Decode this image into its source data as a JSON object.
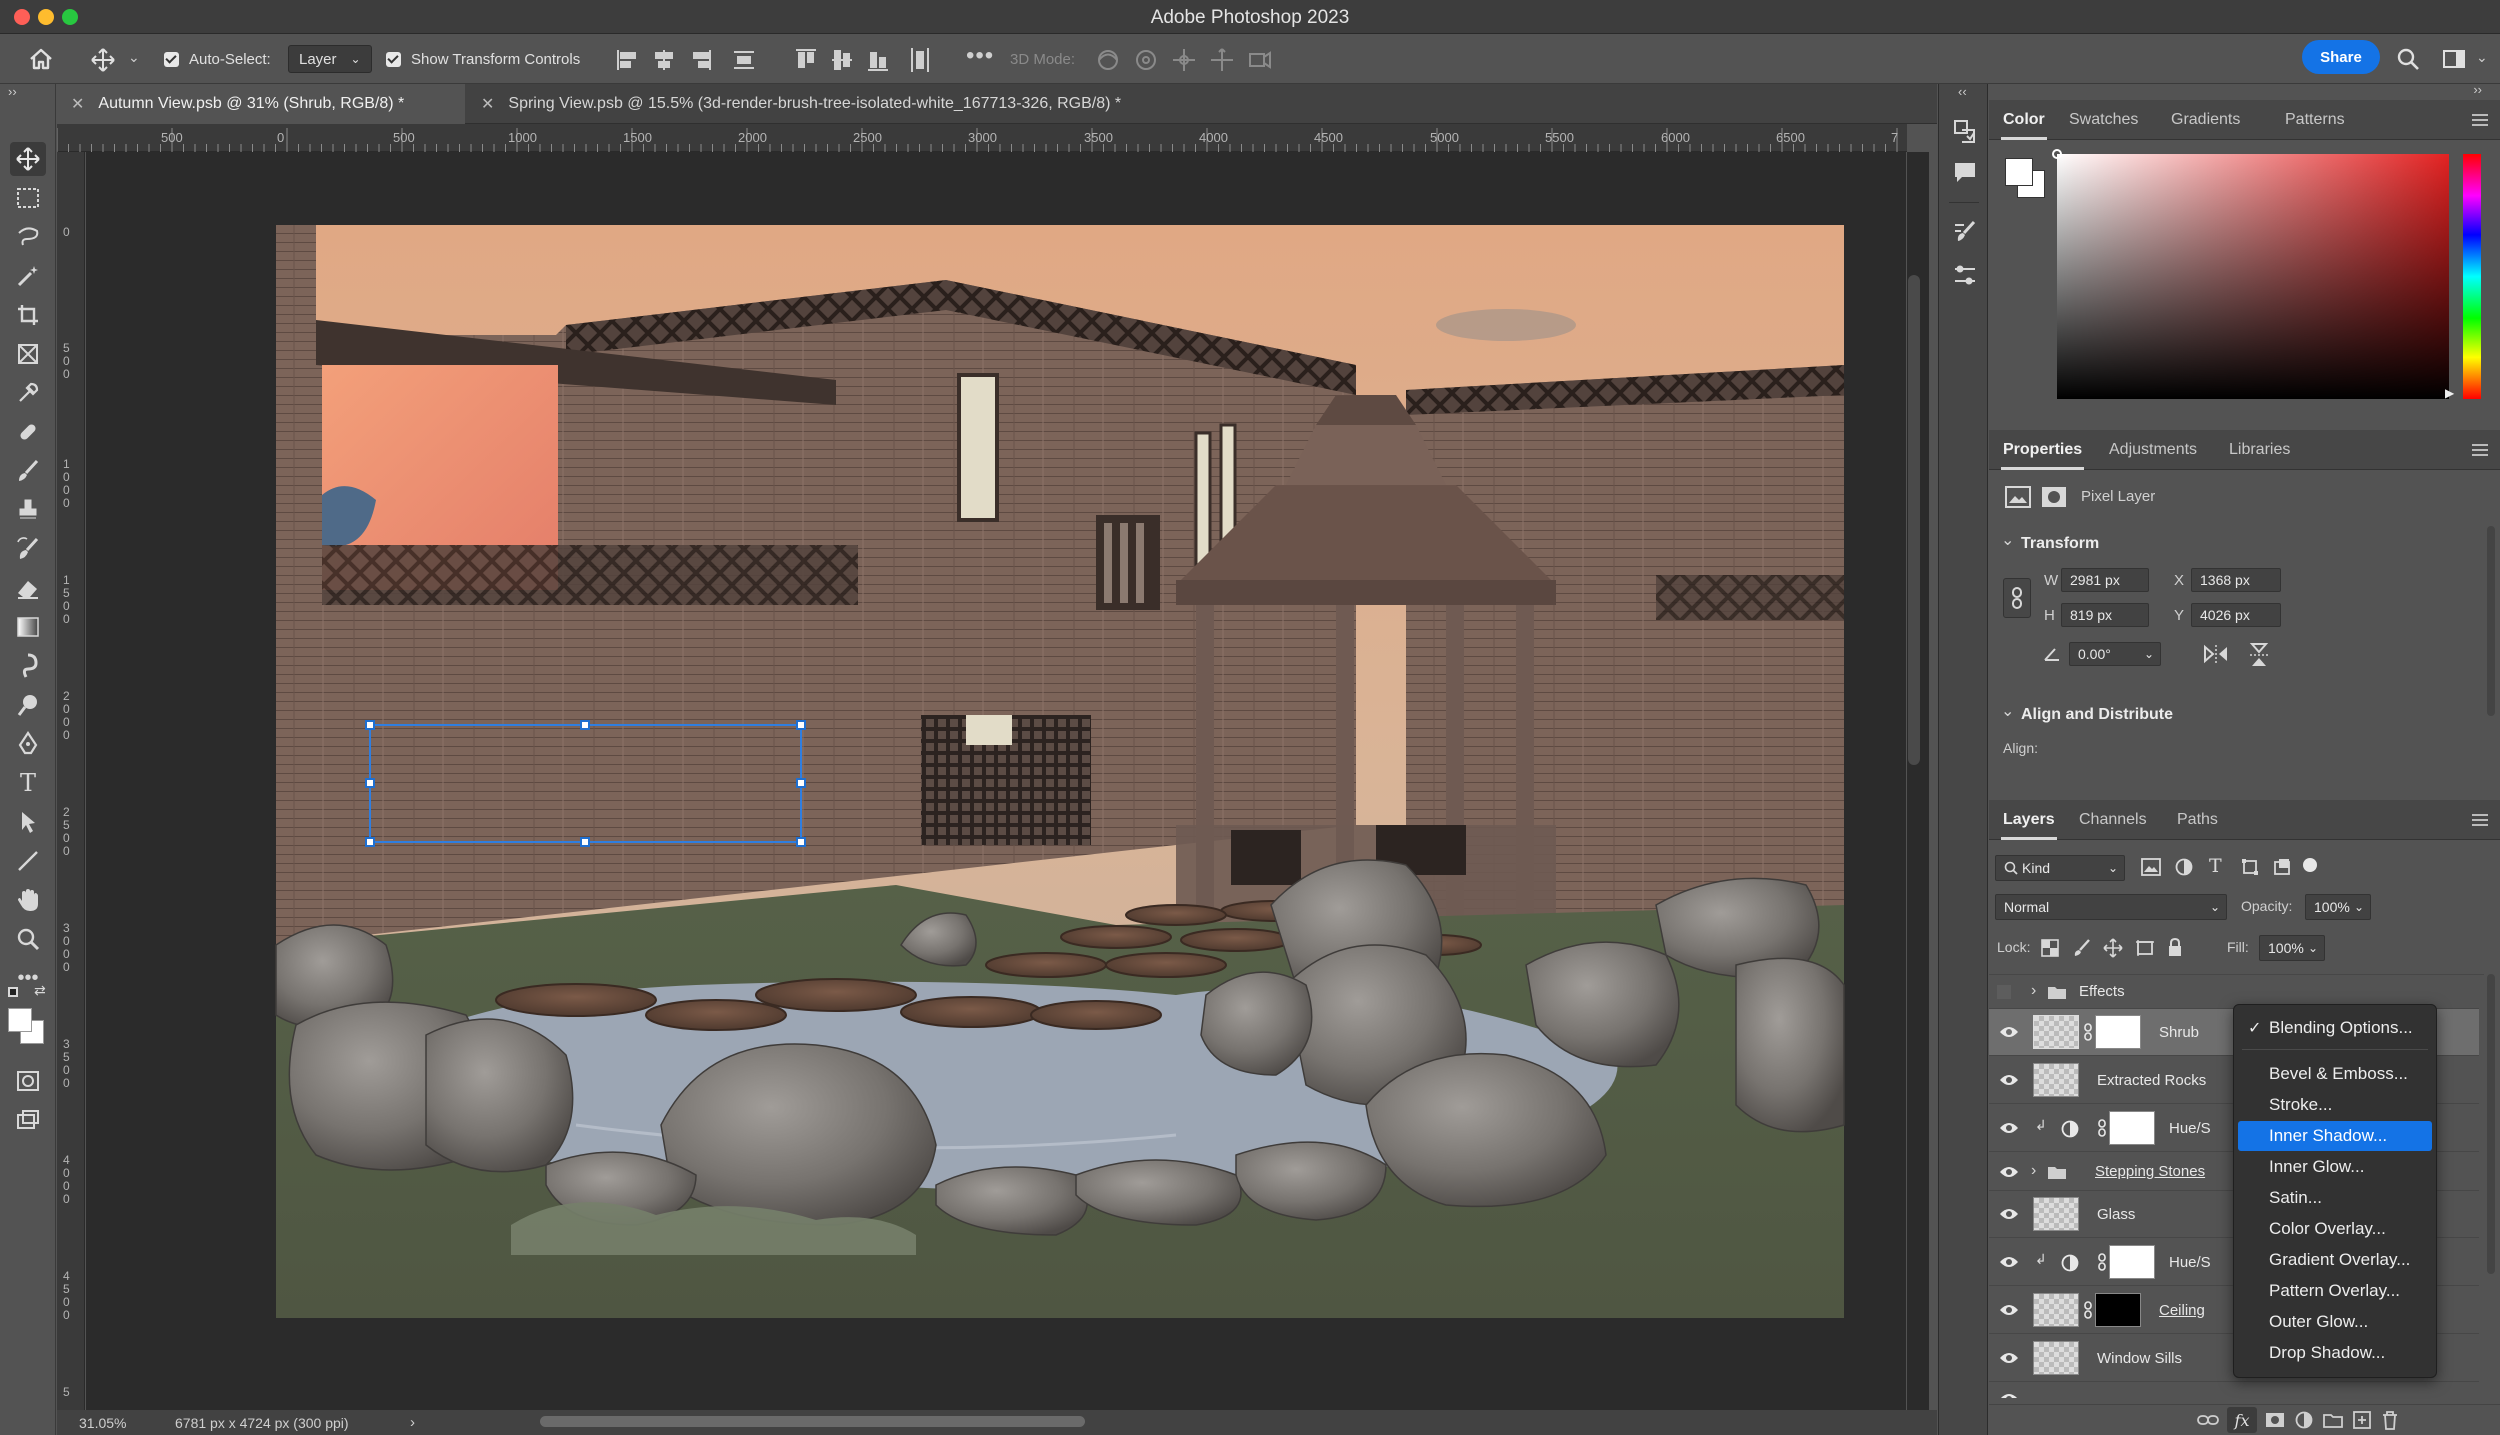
{
  "window": {
    "title": "Adobe Photoshop 2023"
  },
  "options_bar": {
    "auto_select_label": "Auto-Select:",
    "auto_select_target": "Layer",
    "show_transform_label": "Show Transform Controls",
    "mode_3d_label": "3D Mode:",
    "share_label": "Share"
  },
  "tabs": [
    {
      "label": "Autumn View.psb @ 31% (Shrub, RGB/8) *"
    },
    {
      "label": "Spring View.psb @ 15.5% (3d-render-brush-tree-isolated-white_167713-326, RGB/8) *"
    }
  ],
  "ruler_top_ticks": [
    "500",
    "0",
    "500",
    "1000",
    "1500",
    "2000",
    "2500",
    "3000",
    "3500",
    "4000",
    "4500",
    "5000",
    "5500",
    "6000",
    "6500",
    "7"
  ],
  "ruler_left_ticks": [
    "0",
    "500",
    "1000",
    "1500",
    "2000",
    "2500",
    "3000",
    "3500",
    "4000",
    "4500",
    "5"
  ],
  "status": {
    "zoom": "31.05%",
    "doc_info": "6781 px x 4724 px (300 ppi)"
  },
  "color_panel": {
    "tabs": [
      "Color",
      "Swatches",
      "Gradients",
      "Patterns"
    ],
    "active": "Color",
    "hue_color": "#e32222"
  },
  "properties_panel": {
    "tabs": [
      "Properties",
      "Adjustments",
      "Libraries"
    ],
    "layer_type": "Pixel Layer",
    "transform_title": "Transform",
    "w_label": "W",
    "w": "2981 px",
    "h_label": "H",
    "h": "819 px",
    "x_label": "X",
    "x": "1368 px",
    "y_label": "Y",
    "y": "4026 px",
    "angle": "0.00°",
    "align_title": "Align and Distribute",
    "align_label": "Align:"
  },
  "layers_panel": {
    "tabs": [
      "Layers",
      "Channels",
      "Paths"
    ],
    "filter_kind": "Kind",
    "blend_mode": "Normal",
    "opacity_label": "Opacity:",
    "opacity": "100%",
    "lock_label": "Lock:",
    "fill_label": "Fill:",
    "fill": "100%",
    "layers": [
      {
        "name": "Effects"
      },
      {
        "name": "Shrub"
      },
      {
        "name": "Extracted Rocks"
      },
      {
        "name": "Hue/S"
      },
      {
        "name": "Stepping Stones"
      },
      {
        "name": "Glass"
      },
      {
        "name": "Hue/S"
      },
      {
        "name": "Ceiling"
      },
      {
        "name": "Window Sills"
      }
    ]
  },
  "context_menu": {
    "items": [
      {
        "label": "Blending Options...",
        "checked": true
      },
      {
        "label": "Bevel & Emboss..."
      },
      {
        "label": "Stroke..."
      },
      {
        "label": "Inner Shadow...",
        "highlighted": true
      },
      {
        "label": "Inner Glow..."
      },
      {
        "label": "Satin..."
      },
      {
        "label": "Color Overlay..."
      },
      {
        "label": "Gradient Overlay..."
      },
      {
        "label": "Pattern Overlay..."
      },
      {
        "label": "Outer Glow..."
      },
      {
        "label": "Drop Shadow..."
      }
    ]
  }
}
